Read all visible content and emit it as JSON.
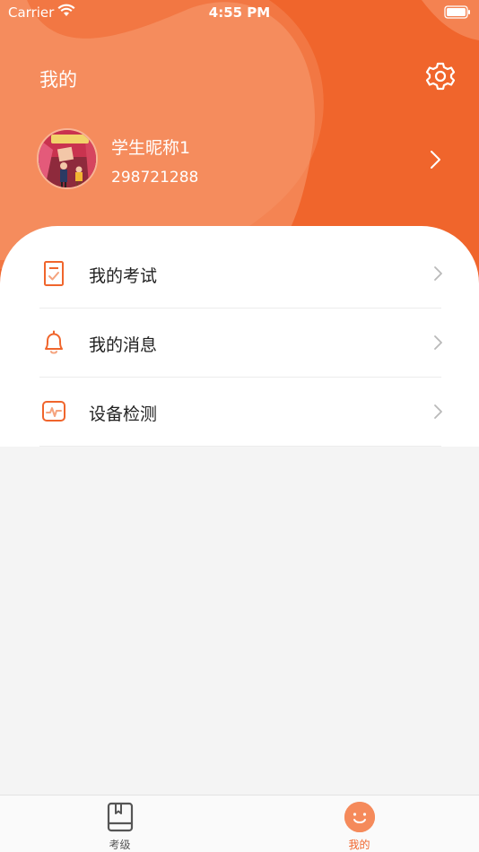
{
  "status_bar": {
    "carrier": "Carrier",
    "time": "4:55 PM"
  },
  "header": {
    "title": "我的",
    "settings_icon": "gear-icon"
  },
  "profile": {
    "nickname": "学生昵称1",
    "user_id": "298721288"
  },
  "menu": [
    {
      "label": "我的考试",
      "icon": "exam-document-icon"
    },
    {
      "label": "我的消息",
      "icon": "bell-icon"
    },
    {
      "label": "设备检测",
      "icon": "monitor-pulse-icon"
    }
  ],
  "tab_bar": {
    "tabs": [
      {
        "label": "考级",
        "icon": "book-icon",
        "active": false
      },
      {
        "label": "我的",
        "icon": "smiley-icon",
        "active": true
      }
    ]
  },
  "colors": {
    "accent": "#f0652c",
    "accent_light": "#f58a5b",
    "tab_inactive": "#555555",
    "tab_active": "#f0652c"
  }
}
